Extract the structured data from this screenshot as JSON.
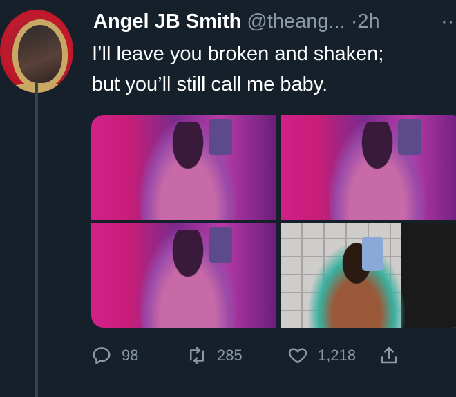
{
  "tweet": {
    "author_name": "Angel JB Smith",
    "handle": "@theang...",
    "separator": "·",
    "time": "2h",
    "more": "··",
    "text_line1": "I’ll leave you broken and shaken;",
    "text_line2": "but you’ll still call me baby."
  },
  "actions": {
    "replies": "98",
    "retweets": "285",
    "likes": "1,218"
  },
  "icons": {
    "reply": "reply-icon",
    "retweet": "retweet-icon",
    "like": "heart-icon",
    "share": "share-icon"
  },
  "colors": {
    "background": "#15202b",
    "secondary_text": "#8b98a5",
    "thread_line": "#38444d"
  }
}
